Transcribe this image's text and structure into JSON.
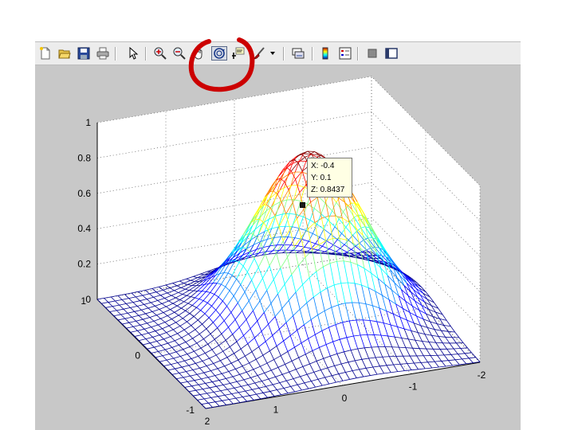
{
  "toolbar": {
    "buttons": [
      {
        "name": "new-figure-icon",
        "pressed": false
      },
      {
        "name": "open-file-icon",
        "pressed": false
      },
      {
        "name": "save-figure-icon",
        "pressed": false
      },
      {
        "name": "print-figure-icon",
        "pressed": false
      },
      {
        "name": "edit-plot-arrow-icon",
        "pressed": false
      },
      {
        "name": "zoom-in-icon",
        "pressed": false
      },
      {
        "name": "zoom-out-icon",
        "pressed": false
      },
      {
        "name": "pan-hand-icon",
        "pressed": false
      },
      {
        "name": "rotate-3d-icon",
        "pressed": true
      },
      {
        "name": "data-cursor-icon",
        "pressed": false
      },
      {
        "name": "brush-icon",
        "pressed": false
      },
      {
        "name": "link-plot-icon",
        "pressed": false
      },
      {
        "name": "colorbar-icon",
        "pressed": false
      },
      {
        "name": "legend-icon",
        "pressed": false
      },
      {
        "name": "hide-plot-tools-icon",
        "pressed": false
      },
      {
        "name": "show-plot-tools-icon",
        "pressed": false
      }
    ]
  },
  "plot": {
    "type": "mesh",
    "surface": "Gaussian peak",
    "x_ticks": [
      "-2",
      "-1",
      "0",
      "1",
      "2"
    ],
    "y_ticks": [
      "-1",
      "0",
      "1"
    ],
    "z_ticks": [
      "0",
      "0.2",
      "0.4",
      "0.6",
      "0.8",
      "1"
    ],
    "colormap": [
      "#00008f",
      "#0000ff",
      "#0080ff",
      "#00ffff",
      "#80ff80",
      "#ffff00",
      "#ff8000",
      "#ff0000",
      "#800000"
    ]
  },
  "datatip": {
    "x": "X: -0.4",
    "y": "Y: 0.1",
    "z": "Z: 0.8437"
  },
  "highlight_color": "#cc0000"
}
